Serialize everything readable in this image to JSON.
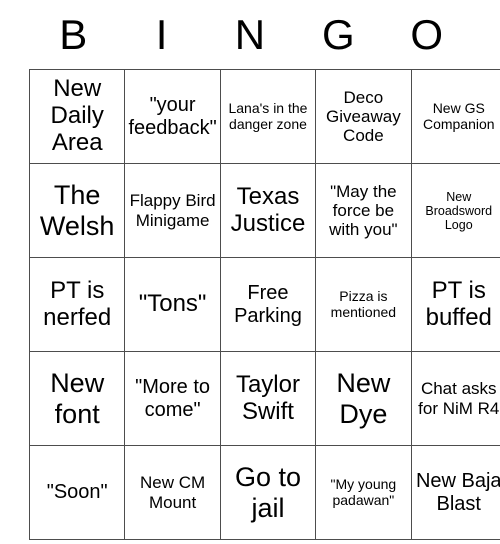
{
  "card": {
    "header_letters": [
      "B",
      "I",
      "N",
      "G",
      "O"
    ],
    "columns": 5,
    "rows": 5,
    "border_color": "#4d4d4d",
    "background_color": "#ffffff",
    "text_color": "#000000",
    "cells": [
      [
        {
          "text": "New Daily Area",
          "size": "lg"
        },
        {
          "text": "\"your feedback\"",
          "size": "md"
        },
        {
          "text": "Lana's in the danger zone",
          "size": "xs"
        },
        {
          "text": "Deco Giveaway Code",
          "size": "sm"
        },
        {
          "text": "New GS Companion",
          "size": "xs"
        }
      ],
      [
        {
          "text": "The Welsh",
          "size": "xl"
        },
        {
          "text": "Flappy Bird Minigame",
          "size": "sm"
        },
        {
          "text": "Texas Justice",
          "size": "lg"
        },
        {
          "text": "\"May the force be with you\"",
          "size": "sm"
        },
        {
          "text": "New Broadsword Logo",
          "size": "xxs"
        }
      ],
      [
        {
          "text": "PT is nerfed",
          "size": "lg"
        },
        {
          "text": "\"Tons\"",
          "size": "lg"
        },
        {
          "text": "Free Parking",
          "size": "md"
        },
        {
          "text": "Pizza is mentioned",
          "size": "xs"
        },
        {
          "text": "PT is buffed",
          "size": "lg"
        }
      ],
      [
        {
          "text": "New font",
          "size": "xl"
        },
        {
          "text": "\"More to come\"",
          "size": "md"
        },
        {
          "text": "Taylor Swift",
          "size": "lg"
        },
        {
          "text": "New Dye",
          "size": "xl"
        },
        {
          "text": "Chat asks for NiM R4",
          "size": "sm"
        }
      ],
      [
        {
          "text": "\"Soon\"",
          "size": "md"
        },
        {
          "text": "New CM Mount",
          "size": "sm"
        },
        {
          "text": "Go to jail",
          "size": "xl"
        },
        {
          "text": "\"My young padawan\"",
          "size": "xs"
        },
        {
          "text": "New Baja Blast",
          "size": "md"
        }
      ]
    ]
  }
}
